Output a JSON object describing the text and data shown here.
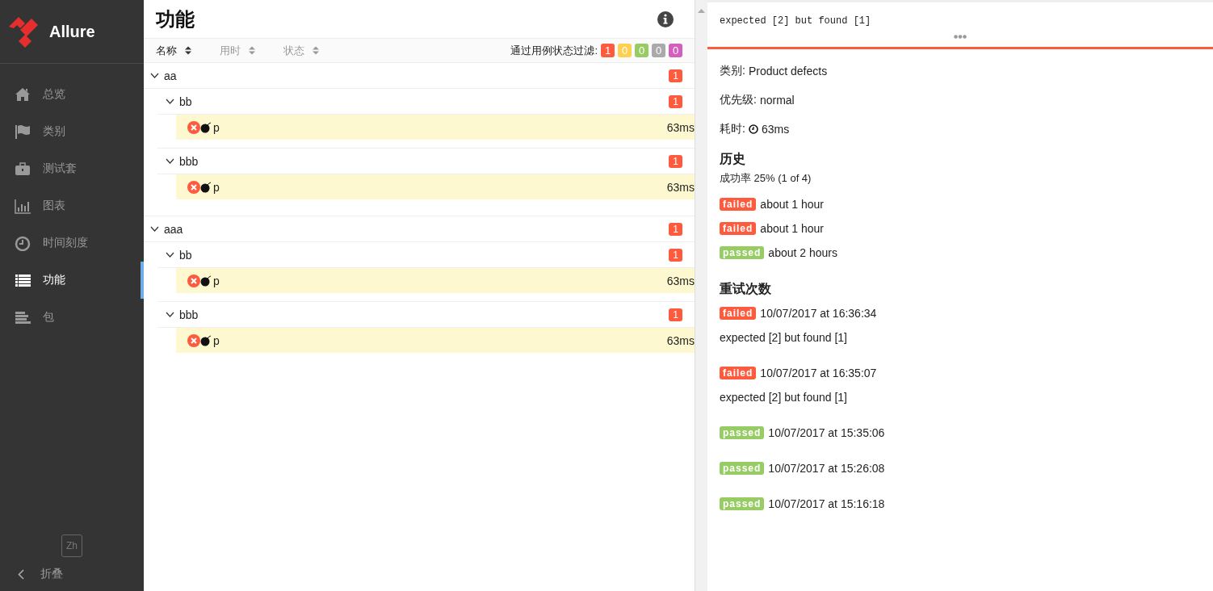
{
  "brand": {
    "name": "Allure"
  },
  "nav": [
    {
      "kind": "home",
      "label": "总览",
      "selected": false
    },
    {
      "kind": "flag",
      "label": "类别",
      "selected": false
    },
    {
      "kind": "briefcase",
      "label": "测试套",
      "selected": false
    },
    {
      "kind": "chart",
      "label": "图表",
      "selected": false
    },
    {
      "kind": "clock",
      "label": "时间刻度",
      "selected": false
    },
    {
      "kind": "list",
      "label": "功能",
      "selected": true
    },
    {
      "kind": "lines",
      "label": "包",
      "selected": false
    }
  ],
  "language": "Zh",
  "collapse": "折叠",
  "page_title": "功能",
  "sort_columns": [
    {
      "label": "名称",
      "selected": true
    },
    {
      "label": "用时",
      "selected": false
    },
    {
      "label": "状态",
      "selected": false
    }
  ],
  "filter": {
    "label": "通过用例状态过滤:",
    "statuses": [
      {
        "count": "1",
        "color": "#fd5a3e"
      },
      {
        "count": "0",
        "color": "#ffd050"
      },
      {
        "count": "0",
        "color": "#97cc64"
      },
      {
        "count": "0",
        "color": "#aaaaaa"
      },
      {
        "count": "0",
        "color": "#d35ebe"
      }
    ]
  },
  "tree": [
    {
      "name": "aa",
      "count": "1",
      "expanded": true,
      "children": [
        {
          "name": "bb",
          "count": "1",
          "expanded": true,
          "children": [
            {
              "name": "p",
              "kind": "failed",
              "flaky": true,
              "duration": "63ms",
              "selected": true
            }
          ]
        },
        {
          "name": "bbb",
          "count": "1",
          "expanded": true,
          "children": [
            {
              "name": "p",
              "kind": "failed",
              "flaky": true,
              "duration": "63ms",
              "selected": true
            }
          ]
        }
      ]
    },
    {
      "name": "aaa",
      "count": "1",
      "expanded": true,
      "children": [
        {
          "name": "bb",
          "count": "1",
          "expanded": true,
          "children": [
            {
              "name": "p",
              "kind": "failed",
              "flaky": true,
              "duration": "63ms",
              "selected": true
            }
          ]
        },
        {
          "name": "bbb",
          "count": "1",
          "expanded": true,
          "children": [
            {
              "name": "p",
              "kind": "failed",
              "flaky": true,
              "duration": "63ms",
              "selected": true
            }
          ]
        }
      ]
    }
  ],
  "detail": {
    "message": "expected [2] but found [1]",
    "kind": "failed",
    "fields": [
      {
        "label": "类别:",
        "value": "Product defects"
      },
      {
        "label": "优先级:",
        "value": "normal"
      },
      {
        "label": "耗时:",
        "value": "63ms",
        "kind": "duration"
      }
    ],
    "history": {
      "title": "历史",
      "rate": "成功率 25% (1 of 4)",
      "items": [
        {
          "status": "failed",
          "text": "about 1 hour"
        },
        {
          "status": "failed",
          "text": "about 1 hour"
        },
        {
          "status": "passed",
          "text": "about 2 hours"
        }
      ]
    },
    "retries": {
      "title": "重试次数",
      "items": [
        {
          "status": "failed",
          "time": "10/07/2017 at 16:36:34",
          "message": "expected [2] but found [1]"
        },
        {
          "status": "failed",
          "time": "10/07/2017 at 16:35:07",
          "message": "expected [2] but found [1]"
        },
        {
          "status": "passed",
          "time": "10/07/2017 at 15:35:06"
        },
        {
          "status": "passed",
          "time": "10/07/2017 at 15:26:08"
        },
        {
          "status": "passed",
          "time": "10/07/2017 at 15:16:18"
        }
      ]
    }
  }
}
